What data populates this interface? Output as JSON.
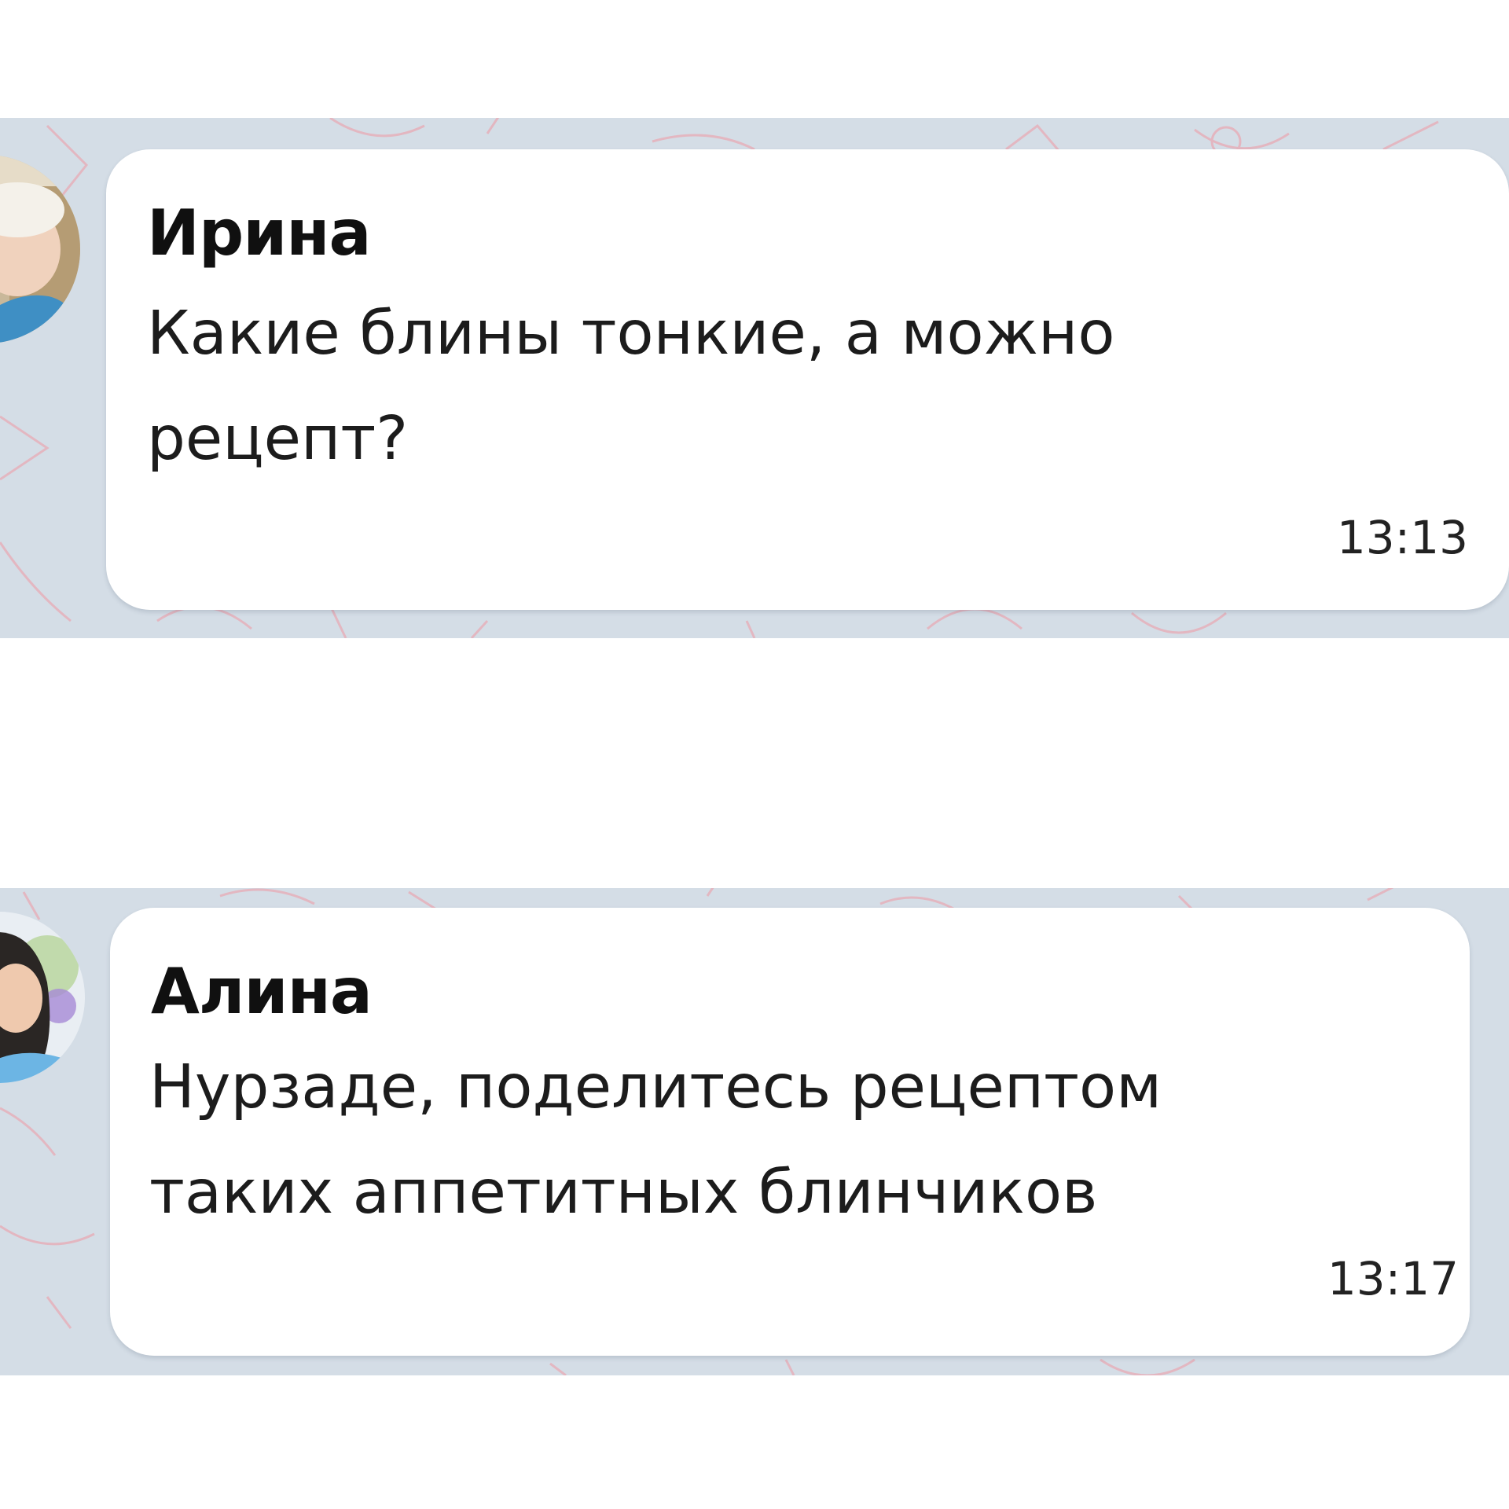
{
  "messages": [
    {
      "sender": "Ирина",
      "text": "Какие блины тонкие, а можно\nрецепт?",
      "time": "13:13",
      "avatar_icon": "user-photo-avatar"
    },
    {
      "sender": "Алина",
      "text": "Нурзаде, поделитесь рецептом\nтаких аппетитных блинчиков",
      "time": "13:17",
      "avatar_icon": "user-illustrated-avatar"
    }
  ],
  "colors": {
    "chat_background": "#d4dde6",
    "bubble": "#ffffff",
    "doodle": "#e8a9b4",
    "page": "#ffffff"
  }
}
